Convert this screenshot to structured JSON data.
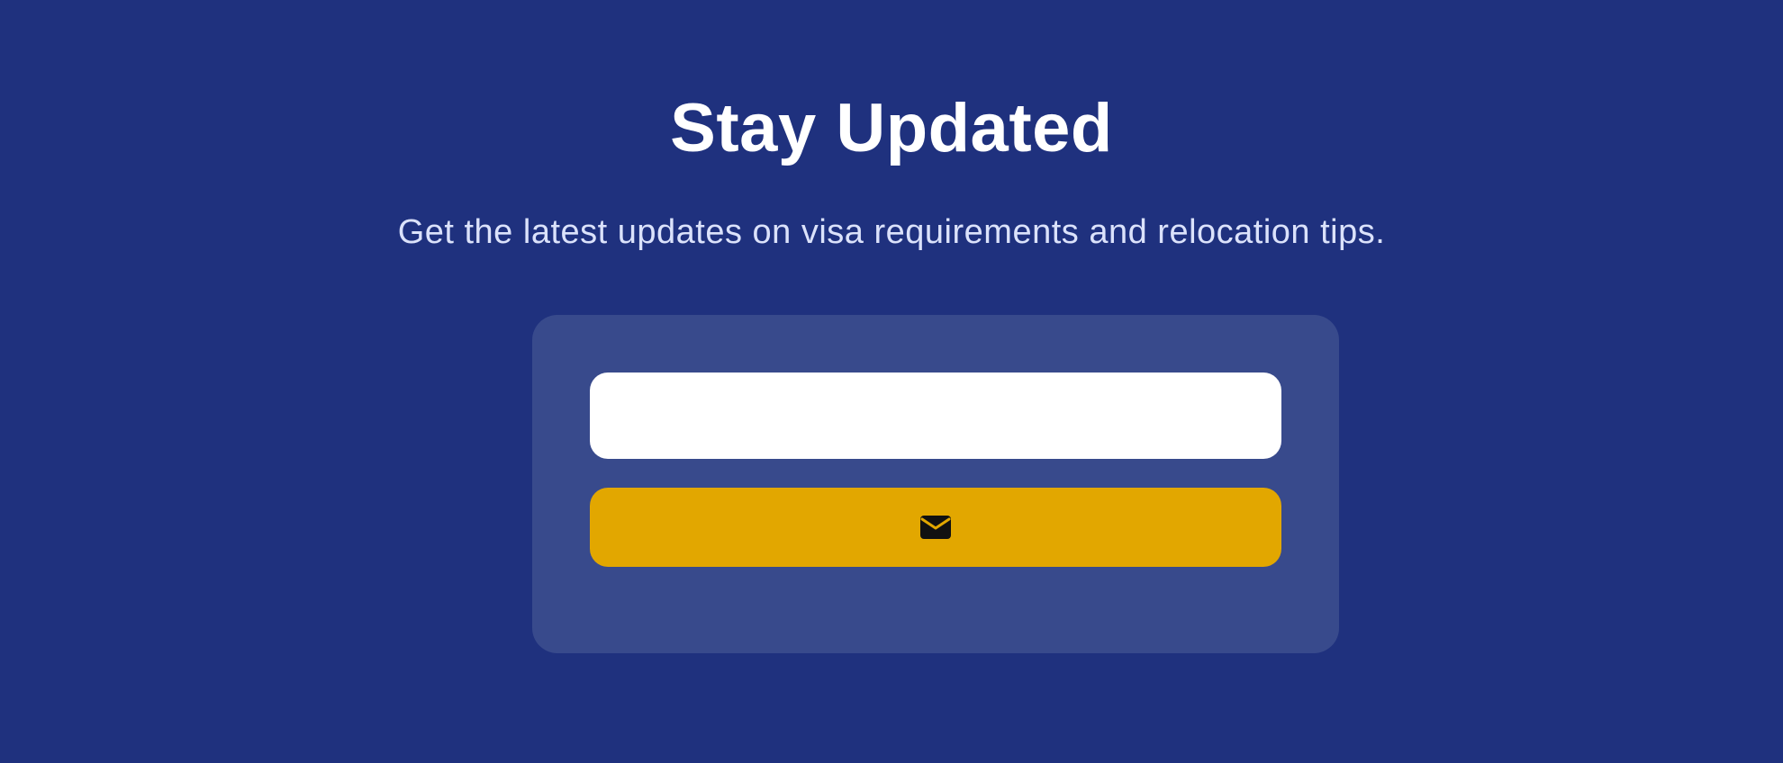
{
  "newsletter": {
    "title": "Stay Updated",
    "subtitle": "Get the latest updates on visa requirements and relocation tips.",
    "email_input": {
      "value": "",
      "placeholder": ""
    },
    "subscribe_button": {
      "label": "",
      "icon": "envelope-icon"
    }
  },
  "colors": {
    "background": "#1f317e",
    "card": "#384a8c",
    "input": "#ffffff",
    "button": "#e2a700",
    "title": "#ffffff",
    "subtitle": "#dbe2fb"
  }
}
